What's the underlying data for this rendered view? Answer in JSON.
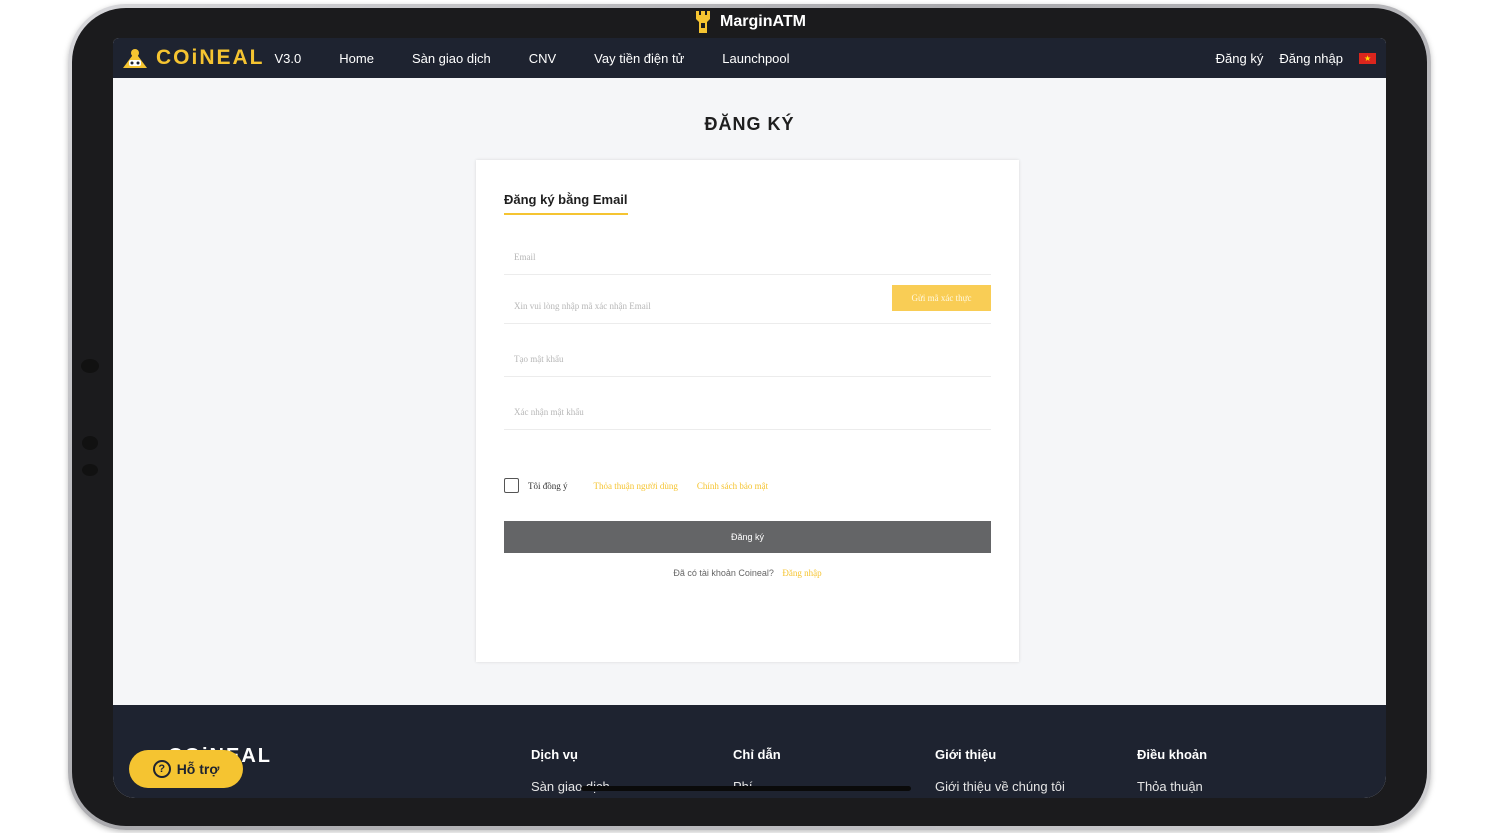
{
  "watermark": {
    "text": "MarginATM"
  },
  "navbar": {
    "logo_text": "COiNEAL",
    "version": "V3.0",
    "links": [
      "Home",
      "Sàn giao dịch",
      "CNV",
      "Vay tiền điện tử",
      "Launchpool"
    ],
    "register": "Đăng ký",
    "login": "Đăng nhập",
    "flag_icon": "vietnam-flag-icon"
  },
  "page": {
    "title": "ĐĂNG KÝ"
  },
  "form": {
    "tab_label": "Đăng ký bằng Email",
    "email_placeholder": "Email",
    "code_placeholder": "Xin vui lòng nhập mã xác nhận Email",
    "send_code_label": "Gửi mã xác thực",
    "password_placeholder": "Tạo mật khẩu",
    "confirm_password_placeholder": "Xác nhận mật khẩu",
    "agree_text": "Tôi đồng ý",
    "terms_link": "Thỏa thuận người dùng",
    "privacy_link": "Chính sách bảo mật",
    "submit_label": "Đăng ký",
    "have_account_text": "Đã có tài khoản Coineal?",
    "login_link": "Đăng nhập"
  },
  "footer": {
    "logo_text": "COiNEAL",
    "columns": [
      {
        "head": "Dịch vụ",
        "item": "Sàn giao dịch"
      },
      {
        "head": "Chỉ dẫn",
        "item": "Phí"
      },
      {
        "head": "Giới thiệu",
        "item": "Giới thiệu về chúng tôi"
      },
      {
        "head": "Điều khoản",
        "item": "Thỏa thuận"
      }
    ]
  },
  "support": {
    "label": "Hỗ trợ"
  },
  "colors": {
    "accent": "#f5c431",
    "navbar_bg": "#1e2330",
    "submit_bg": "#646567"
  }
}
